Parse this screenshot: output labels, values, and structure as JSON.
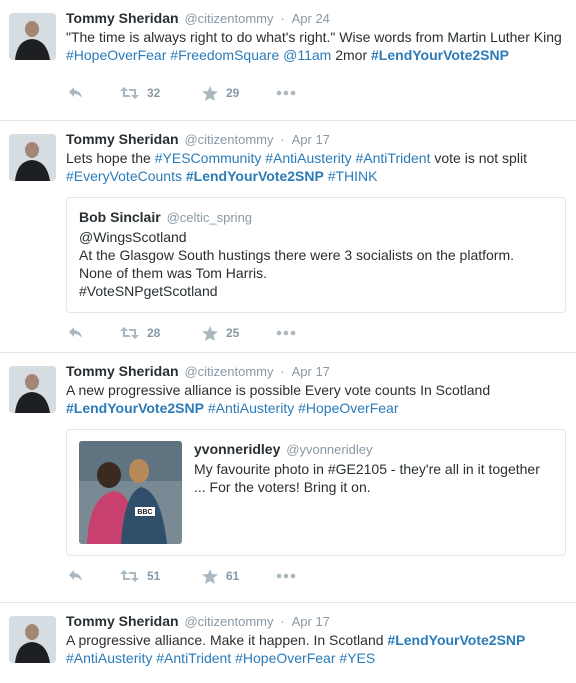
{
  "tweets": [
    {
      "name": "Tommy Sheridan",
      "handle": "@citizentommy",
      "sep": "·",
      "time": "Apr 24",
      "text": [
        {
          "t": "\"The time is always right to do what's right.\" Wise words from Martin Luther King ",
          "k": "plain"
        },
        {
          "t": "#HopeOverFear",
          "k": "link"
        },
        {
          "t": " ",
          "k": "plain"
        },
        {
          "t": "#FreedomSquare",
          "k": "link"
        },
        {
          "t": " ",
          "k": "plain"
        },
        {
          "t": "@11am",
          "k": "link"
        },
        {
          "t": " 2mor ",
          "k": "plain"
        },
        {
          "t": "#LendYourVote2SNP",
          "k": "bold"
        }
      ],
      "retweets": "32",
      "favorites": "29"
    },
    {
      "name": "Tommy Sheridan",
      "handle": "@citizentommy",
      "sep": "·",
      "time": "Apr 17",
      "text": [
        {
          "t": "Lets hope the ",
          "k": "plain"
        },
        {
          "t": "#YESCommunity",
          "k": "link"
        },
        {
          "t": " ",
          "k": "plain"
        },
        {
          "t": "#AntiAusterity",
          "k": "link"
        },
        {
          "t": " ",
          "k": "plain"
        },
        {
          "t": "#AntiTrident",
          "k": "link"
        },
        {
          "t": " vote is not split ",
          "k": "plain"
        },
        {
          "t": "#EveryVoteCounts",
          "k": "link"
        },
        {
          "t": " ",
          "k": "plain"
        },
        {
          "t": "#LendYourVote2SNP",
          "k": "bold"
        },
        {
          "t": " ",
          "k": "plain"
        },
        {
          "t": "#THINK",
          "k": "link"
        }
      ],
      "quote": {
        "name": "Bob Sinclair",
        "handle": "@celtic_spring",
        "lines": [
          "@WingsScotland",
          "At the Glasgow South hustings there were 3 socialists on the platform.",
          "None of them was Tom Harris.",
          "#VoteSNPgetScotland"
        ]
      },
      "retweets": "28",
      "favorites": "25"
    },
    {
      "name": "Tommy Sheridan",
      "handle": "@citizentommy",
      "sep": "·",
      "time": "Apr 17",
      "text": [
        {
          "t": "A new progressive alliance is possible Every vote counts In Scotland ",
          "k": "plain"
        },
        {
          "t": "#LendYourVote2SNP",
          "k": "bold"
        },
        {
          "t": " ",
          "k": "plain"
        },
        {
          "t": "#AntiAusterity",
          "k": "link"
        },
        {
          "t": " ",
          "k": "plain"
        },
        {
          "t": "#HopeOverFear",
          "k": "link"
        }
      ],
      "media_quote": {
        "name": "yvonneridley",
        "handle": "@yvonneridley",
        "text": "My favourite photo in #GE2105 - they're all in it together ... For the voters! Bring it on.",
        "image_badge": "BBC"
      },
      "retweets": "51",
      "favorites": "61"
    },
    {
      "name": "Tommy Sheridan",
      "handle": "@citizentommy",
      "sep": "·",
      "time": "Apr 17",
      "text": [
        {
          "t": "A progressive alliance. Make it happen. In Scotland ",
          "k": "plain"
        },
        {
          "t": "#LendYourVote2SNP",
          "k": "bold"
        },
        {
          "t": " ",
          "k": "plain"
        },
        {
          "t": "#AntiAusterity",
          "k": "link"
        },
        {
          "t": " ",
          "k": "plain"
        },
        {
          "t": "#AntiTrident",
          "k": "link"
        },
        {
          "t": " ",
          "k": "plain"
        },
        {
          "t": "#HopeOverFear",
          "k": "link"
        },
        {
          "t": " ",
          "k": "plain"
        },
        {
          "t": "#YES",
          "k": "link"
        }
      ]
    }
  ],
  "colors": {
    "link": "#2b7bb9",
    "muted": "#8899a6",
    "text": "#292f33",
    "border": "#e1e8ed"
  },
  "icons": [
    "reply-icon",
    "retweet-icon",
    "favorite-icon",
    "more-icon"
  ]
}
